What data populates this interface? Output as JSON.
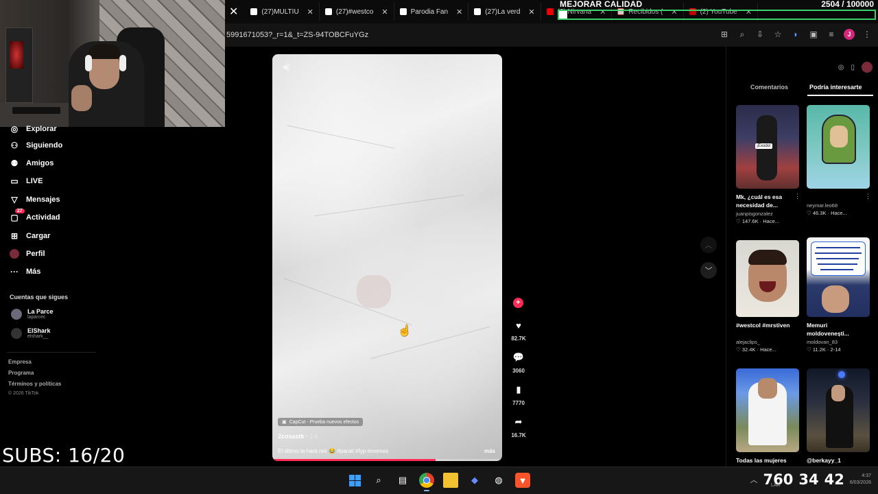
{
  "browser": {
    "tabs": [
      {
        "label": "(27)MULTIU",
        "icon": "tiktok"
      },
      {
        "label": "(27)#westco",
        "icon": "tiktok"
      },
      {
        "label": "Parodia Fan",
        "icon": "tiktok"
      },
      {
        "label": "(27)La verd",
        "icon": "tiktok"
      },
      {
        "label": "(2) Nirvana",
        "icon": "youtube"
      },
      {
        "label": "Recibidos (",
        "icon": "gmail"
      },
      {
        "label": "(2) YouTube",
        "icon": "youtube"
      }
    ],
    "url": "5991671053?_r=1&_t=ZS-94TOBCFuYGz",
    "profile_initial": "J"
  },
  "stream_overlay": {
    "goal_title": "MEJORAR CALIDAD",
    "goal_count": "2504 / 100000",
    "goal_progress": 0.025,
    "subs": "SUBS: 16/20"
  },
  "sidebar": {
    "items": [
      {
        "label": "Explorar",
        "icon": "compass-icon"
      },
      {
        "label": "Siguiendo",
        "icon": "following-icon"
      },
      {
        "label": "Amigos",
        "icon": "friends-icon"
      },
      {
        "label": "LIVE",
        "icon": "live-icon"
      },
      {
        "label": "Mensajes",
        "icon": "messages-icon"
      },
      {
        "label": "Actividad",
        "icon": "activity-icon",
        "badge": "27"
      },
      {
        "label": "Cargar",
        "icon": "upload-icon"
      },
      {
        "label": "Perfil",
        "icon": "profile-icon"
      },
      {
        "label": "Más",
        "icon": "more-icon"
      }
    ],
    "following_header": "Cuentas que sigues",
    "accounts": [
      {
        "name": "La Parce",
        "handle": "laparcec"
      },
      {
        "name": "ElShark",
        "handle": "elshark__"
      }
    ],
    "footer": [
      "Empresa",
      "Programa",
      "Términos y políticas"
    ],
    "copyright": "© 2026 TikTok"
  },
  "video": {
    "effect_chip": "CapCut - Prueba nuevos efectos",
    "author": "2cosastk",
    "date": "1-4",
    "caption": "El último te hará reír 😂 #parati #fyp #memes",
    "more": "más",
    "progress": 0.71
  },
  "actions": {
    "likes": "82.7K",
    "comments": "3060",
    "saves": "7770",
    "shares": "16.7K"
  },
  "right_panel": {
    "tabs": [
      "Comentarios",
      "Podría interesarte"
    ],
    "cards": [
      {
        "title": "Mk, ¿cuál es esa necesidad de...",
        "user": "juanpisgonzalez",
        "likes": "147.6K",
        "age": "Hace...",
        "thumb_label": "¡Exodo!"
      },
      {
        "title": "",
        "user": "neymar.leo68",
        "likes": "46.3K",
        "age": "Hace..."
      },
      {
        "title": "#westcol #mrstiven",
        "user": "alejaclips_",
        "likes": "32.4K",
        "age": "Hace..."
      },
      {
        "title": "Memuri moldovenești...",
        "user": "moldovan_83",
        "likes": "11.2K",
        "age": "2-14"
      },
      {
        "title": "Todas las mujeres",
        "user": "",
        "likes": "",
        "age": ""
      },
      {
        "title": "@berkayy_1",
        "user": "",
        "likes": "",
        "age": ""
      }
    ]
  },
  "taskbar": {
    "big_num_1": "760",
    "big_num_2": "34",
    "big_num_3": "42",
    "time": "4:37",
    "date": "6/03/2026",
    "lang": "LAA"
  },
  "colors": {
    "accent": "#fe2c55",
    "goal_border": "#3ad16a"
  }
}
